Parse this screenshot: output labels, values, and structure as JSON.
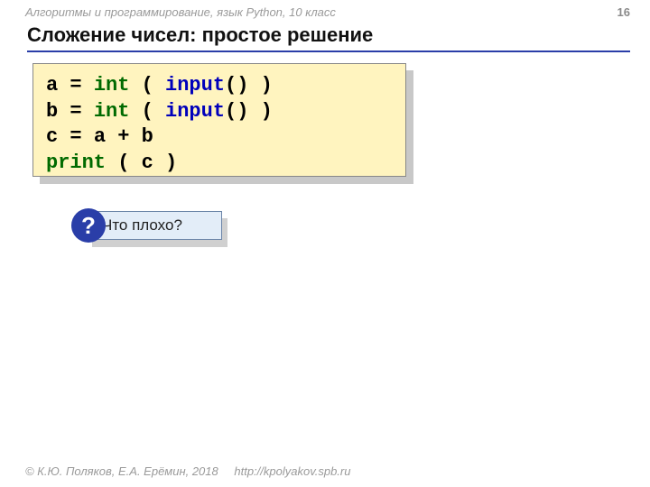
{
  "header": {
    "course": "Алгоритмы и программирование, язык Python, 10 класс",
    "page": "16"
  },
  "title": "Сложение чисел: простое решение",
  "code": {
    "lines": [
      {
        "tokens": [
          {
            "t": "a",
            "c": "id"
          },
          {
            "t": " = ",
            "c": "pn"
          },
          {
            "t": "int",
            "c": "kw"
          },
          {
            "t": " ( ",
            "c": "pn"
          },
          {
            "t": "input",
            "c": "fn"
          },
          {
            "t": "() )",
            "c": "pn"
          }
        ]
      },
      {
        "tokens": [
          {
            "t": "b",
            "c": "id"
          },
          {
            "t": " = ",
            "c": "pn"
          },
          {
            "t": "int",
            "c": "kw"
          },
          {
            "t": " ( ",
            "c": "pn"
          },
          {
            "t": "input",
            "c": "fn"
          },
          {
            "t": "() )",
            "c": "pn"
          }
        ]
      },
      {
        "tokens": [
          {
            "t": "c",
            "c": "id"
          },
          {
            "t": " = ",
            "c": "pn"
          },
          {
            "t": "a",
            "c": "id"
          },
          {
            "t": " + ",
            "c": "pn"
          },
          {
            "t": "b",
            "c": "id"
          }
        ]
      },
      {
        "tokens": [
          {
            "t": "print",
            "c": "kw"
          },
          {
            "t": " ( ",
            "c": "pn"
          },
          {
            "t": "c",
            "c": "id"
          },
          {
            "t": " )",
            "c": "pn"
          }
        ]
      }
    ]
  },
  "callout": {
    "badge": "?",
    "text": "Что плохо?"
  },
  "footer": {
    "copyright": "© К.Ю. Поляков, Е.А. Ерёмин, 2018",
    "url": "http://kpolyakov.spb.ru"
  }
}
